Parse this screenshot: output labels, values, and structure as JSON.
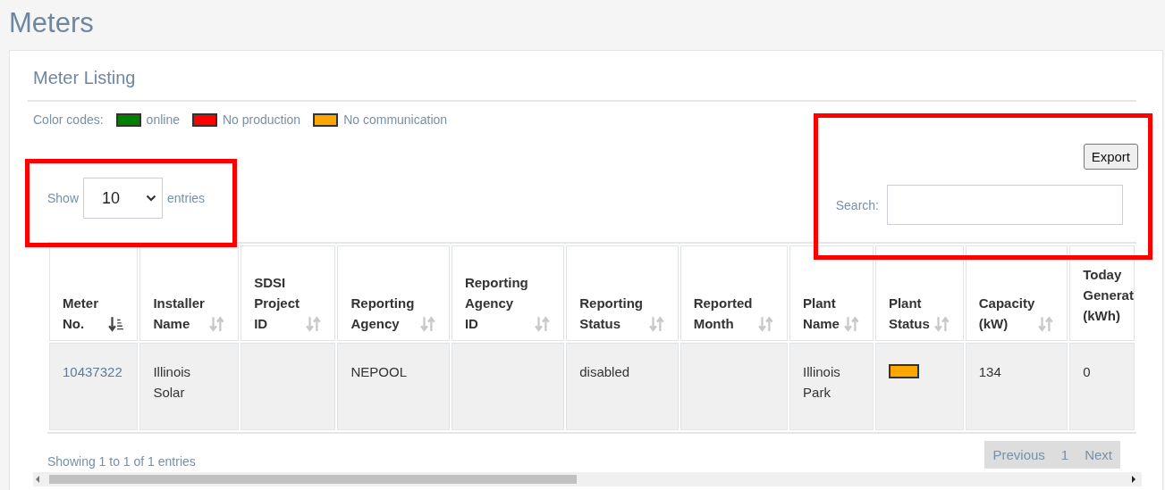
{
  "page": {
    "title": "Meters"
  },
  "panel": {
    "title": "Meter Listing"
  },
  "legend": {
    "label": "Color codes:",
    "items": [
      {
        "label": "online",
        "color": "#008000"
      },
      {
        "label": "No production",
        "color": "#ff0000"
      },
      {
        "label": "No communication",
        "color": "#ffa500"
      }
    ]
  },
  "export_button": "Export",
  "length_menu": {
    "before": "Show",
    "value": "10",
    "after": "entries"
  },
  "search": {
    "label": "Search:"
  },
  "table": {
    "columns": [
      {
        "label": "Meter No.",
        "sorted": true
      },
      {
        "label": "Installer Name",
        "sorted": false
      },
      {
        "label": "SDSI Project ID",
        "sorted": false
      },
      {
        "label": "Reporting Agency",
        "sorted": false
      },
      {
        "label": "Reporting Agency ID",
        "sorted": false
      },
      {
        "label": "Reporting Status",
        "sorted": false
      },
      {
        "label": "Reported Month",
        "sorted": false
      },
      {
        "label": "Plant Name",
        "sorted": false
      },
      {
        "label": "Plant Status",
        "sorted": false
      },
      {
        "label": "Capacity (kW)",
        "sorted": false
      },
      {
        "label": "Today Generat (kWh)"
      }
    ],
    "rows": [
      {
        "cells": [
          {
            "kind": "link",
            "text": "10437322"
          },
          {
            "kind": "text",
            "text": "Illinois Solar"
          },
          {
            "kind": "text"
          },
          {
            "kind": "text",
            "text": "NEPOOL"
          },
          {
            "kind": "text"
          },
          {
            "kind": "text",
            "text": "disabled"
          },
          {
            "kind": "text"
          },
          {
            "kind": "text",
            "text": "Illinois Park"
          },
          {
            "kind": "status",
            "color": "#ffa500"
          },
          {
            "kind": "text",
            "text": "134"
          },
          {
            "kind": "text",
            "text": "0"
          }
        ]
      }
    ]
  },
  "info": "Showing 1 to 1 of 1 entries",
  "pagination": [
    {
      "label": "Previous",
      "disabled": true
    },
    {
      "label": "1",
      "selected": true
    },
    {
      "label": "Next",
      "disabled": true
    }
  ]
}
